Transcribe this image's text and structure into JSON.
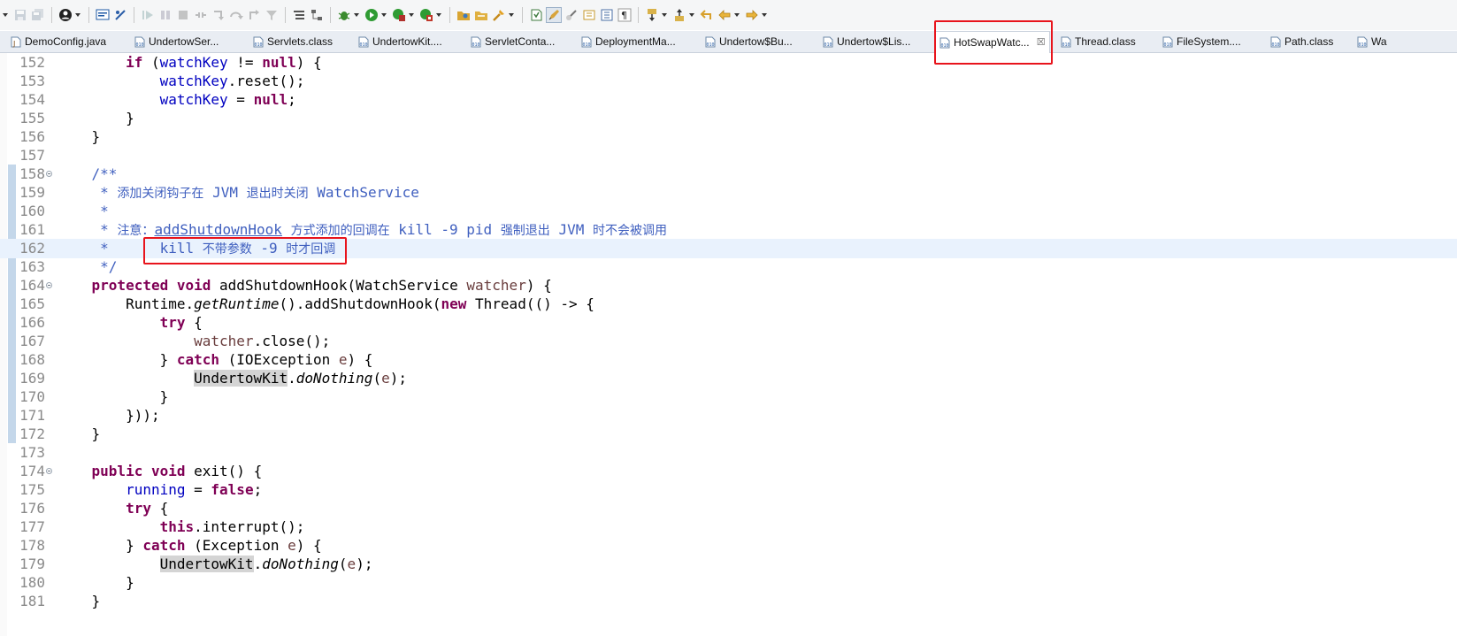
{
  "toolbar": {
    "buttons": [
      "menu-dropdown",
      "save-icon",
      "save-all-icon",
      "user-icon",
      "console-icon",
      "skip-breakpoints-icon",
      "resume-icon",
      "suspend-icon",
      "terminate-icon",
      "disconnect-icon",
      "step-into-icon",
      "step-over-icon",
      "step-return-icon",
      "use-step-filters-icon",
      "debug-icon",
      "run-icon",
      "coverage-icon",
      "external-tools-icon",
      "open-type-icon",
      "open-task-icon",
      "search-icon",
      "toggle-mark-occurrences-icon",
      "toggle-highlight-icon",
      "show-whitespace-icon",
      "pilcrow-icon",
      "next-annotation-icon",
      "previous-annotation-icon",
      "back-icon",
      "forward-icon"
    ]
  },
  "tabs": [
    {
      "label": "DemoConfig.java",
      "kind": "java"
    },
    {
      "label": "UndertowSer...",
      "kind": "class"
    },
    {
      "label": "Servlets.class",
      "kind": "class"
    },
    {
      "label": "UndertowKit....",
      "kind": "class"
    },
    {
      "label": "ServletConta...",
      "kind": "class"
    },
    {
      "label": "DeploymentMa...",
      "kind": "class"
    },
    {
      "label": "Undertow$Bu...",
      "kind": "class"
    },
    {
      "label": "Undertow$Lis...",
      "kind": "class"
    },
    {
      "label": "HotSwapWatc...",
      "kind": "class",
      "active": true,
      "close": "☒"
    },
    {
      "label": "Thread.class",
      "kind": "class"
    },
    {
      "label": "FileSystem....",
      "kind": "class"
    },
    {
      "label": "Path.class",
      "kind": "class"
    },
    {
      "label": "Wa",
      "kind": "class"
    }
  ],
  "editor": {
    "current_line": 162,
    "lines": [
      {
        "num": "152",
        "tokens": [
          [
            "        ",
            ""
          ],
          [
            "if",
            "kw"
          ],
          [
            " (",
            ""
          ],
          [
            "watchKey",
            "fld"
          ],
          [
            " != ",
            ""
          ],
          [
            "null",
            "kw"
          ],
          [
            ") {",
            ""
          ]
        ]
      },
      {
        "num": "153",
        "tokens": [
          [
            "            ",
            ""
          ],
          [
            "watchKey",
            "fld"
          ],
          [
            ".reset();",
            ""
          ]
        ]
      },
      {
        "num": "154",
        "tokens": [
          [
            "            ",
            ""
          ],
          [
            "watchKey",
            "fld"
          ],
          [
            " = ",
            ""
          ],
          [
            "null",
            "kw"
          ],
          [
            ";",
            ""
          ]
        ]
      },
      {
        "num": "155",
        "tokens": [
          [
            "        }",
            ""
          ]
        ]
      },
      {
        "num": "156",
        "tokens": [
          [
            "    }",
            ""
          ]
        ]
      },
      {
        "num": "157",
        "tokens": []
      },
      {
        "num": "158",
        "fold": true,
        "tokens": [
          [
            "    /**",
            "jd"
          ]
        ]
      },
      {
        "num": "159",
        "tokens": [
          [
            "     * ",
            "jd"
          ],
          [
            "添加关闭钩子在",
            "jd cjk"
          ],
          [
            " JVM ",
            "jd"
          ],
          [
            "退出时关闭",
            "jd cjk"
          ],
          [
            " WatchService",
            "jd"
          ]
        ]
      },
      {
        "num": "160",
        "tokens": [
          [
            "     *",
            "jd"
          ]
        ]
      },
      {
        "num": "161",
        "tokens": [
          [
            "     * ",
            "jd"
          ],
          [
            "注意：",
            "jd cjk"
          ],
          [
            "addShutdownHook",
            "jdt"
          ],
          [
            " ",
            "jd"
          ],
          [
            "方式添加的回调在",
            "jd cjk"
          ],
          [
            " kill -9 pid ",
            "jd"
          ],
          [
            "强制退出",
            "jd cjk"
          ],
          [
            " JVM ",
            "jd"
          ],
          [
            "时不会被调用",
            "jd cjk"
          ]
        ]
      },
      {
        "num": "162",
        "tokens": [
          [
            "     *      kill ",
            "jd"
          ],
          [
            "不带参数",
            "jd cjk"
          ],
          [
            " -9 ",
            "jd"
          ],
          [
            "时才回调",
            "jd cjk"
          ]
        ]
      },
      {
        "num": "163",
        "tokens": [
          [
            "     */",
            "jd"
          ]
        ]
      },
      {
        "num": "164",
        "fold": true,
        "tokens": [
          [
            "    ",
            ""
          ],
          [
            "protected",
            "kw"
          ],
          [
            " ",
            ""
          ],
          [
            "void",
            "kw"
          ],
          [
            " addShutdownHook(WatchService ",
            ""
          ],
          [
            "watcher",
            "loc"
          ],
          [
            ") {",
            ""
          ]
        ]
      },
      {
        "num": "165",
        "tokens": [
          [
            "        Runtime.",
            ""
          ],
          [
            "getRuntime",
            "ital"
          ],
          [
            "().addShutdownHook(",
            ""
          ],
          [
            "new",
            "kw"
          ],
          [
            " Thread(() -> {",
            ""
          ]
        ]
      },
      {
        "num": "166",
        "tokens": [
          [
            "            ",
            ""
          ],
          [
            "try",
            "kw"
          ],
          [
            " {",
            ""
          ]
        ]
      },
      {
        "num": "167",
        "tokens": [
          [
            "                ",
            ""
          ],
          [
            "watcher",
            "loc"
          ],
          [
            ".close();",
            ""
          ]
        ]
      },
      {
        "num": "168",
        "tokens": [
          [
            "            } ",
            ""
          ],
          [
            "catch",
            "kw"
          ],
          [
            " (IOException ",
            ""
          ],
          [
            "e",
            "loc"
          ],
          [
            ") {",
            ""
          ]
        ]
      },
      {
        "num": "169",
        "tokens": [
          [
            "                ",
            ""
          ],
          [
            "UndertowKit",
            "occ"
          ],
          [
            ".",
            ""
          ],
          [
            "doNothing",
            "ital"
          ],
          [
            "(",
            ""
          ],
          [
            "e",
            "loc"
          ],
          [
            ");",
            ""
          ]
        ]
      },
      {
        "num": "170",
        "tokens": [
          [
            "            }",
            ""
          ]
        ]
      },
      {
        "num": "171",
        "tokens": [
          [
            "        }));",
            ""
          ]
        ]
      },
      {
        "num": "172",
        "tokens": [
          [
            "    }",
            ""
          ]
        ]
      },
      {
        "num": "173",
        "tokens": []
      },
      {
        "num": "174",
        "fold": true,
        "tokens": [
          [
            "    ",
            ""
          ],
          [
            "public",
            "kw"
          ],
          [
            " ",
            ""
          ],
          [
            "void",
            "kw"
          ],
          [
            " exit() {",
            ""
          ]
        ]
      },
      {
        "num": "175",
        "tokens": [
          [
            "        ",
            ""
          ],
          [
            "running",
            "fld"
          ],
          [
            " = ",
            ""
          ],
          [
            "false",
            "kw"
          ],
          [
            ";",
            ""
          ]
        ]
      },
      {
        "num": "176",
        "tokens": [
          [
            "        ",
            ""
          ],
          [
            "try",
            "kw"
          ],
          [
            " {",
            ""
          ]
        ]
      },
      {
        "num": "177",
        "tokens": [
          [
            "            ",
            ""
          ],
          [
            "this",
            "kw"
          ],
          [
            ".interrupt();",
            ""
          ]
        ]
      },
      {
        "num": "178",
        "tokens": [
          [
            "        } ",
            ""
          ],
          [
            "catch",
            "kw"
          ],
          [
            " (Exception ",
            ""
          ],
          [
            "e",
            "loc"
          ],
          [
            ") {",
            ""
          ]
        ]
      },
      {
        "num": "179",
        "tokens": [
          [
            "            ",
            ""
          ],
          [
            "UndertowKit",
            "occ"
          ],
          [
            ".",
            ""
          ],
          [
            "doNothing",
            "ital"
          ],
          [
            "(",
            ""
          ],
          [
            "e",
            "loc"
          ],
          [
            ");",
            ""
          ]
        ]
      },
      {
        "num": "180",
        "tokens": [
          [
            "        }",
            ""
          ]
        ]
      },
      {
        "num": "181",
        "tokens": [
          [
            "    }",
            ""
          ]
        ]
      }
    ]
  },
  "colors": {
    "keyword": "#7f0055",
    "field": "#0000c0",
    "javadoc": "#3f5fbf",
    "annotation_box": "#e8141c"
  }
}
